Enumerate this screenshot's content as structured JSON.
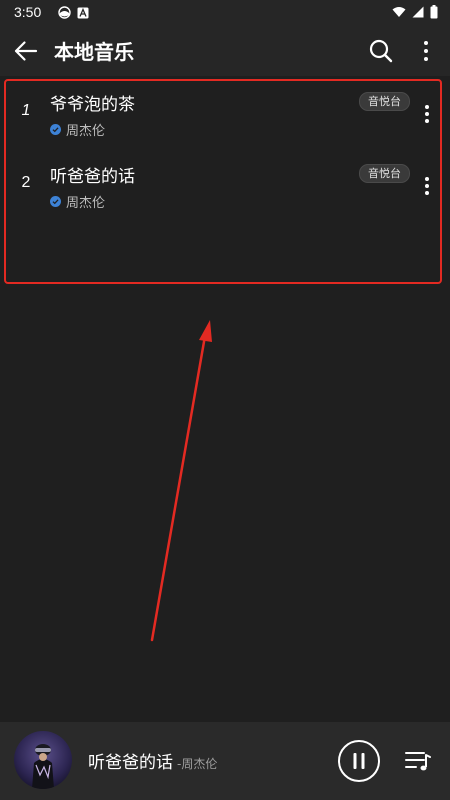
{
  "status_bar": {
    "time": "3:50"
  },
  "app_bar": {
    "title": "本地音乐"
  },
  "songs": [
    {
      "index": "1",
      "title": "爷爷泡的茶",
      "artist": "周杰伦",
      "badge": "音悦台"
    },
    {
      "index": "2",
      "title": "听爸爸的话",
      "artist": "周杰伦",
      "badge": "音悦台"
    }
  ],
  "player": {
    "title": "听爸爸的话",
    "separator": "-",
    "artist": "周杰伦"
  },
  "colors": {
    "background": "#1f1f1f",
    "bars": "#262626",
    "player_bar": "#2a2a2a",
    "verified_blue": "#3d82d6",
    "annotation_red": "#e32a22"
  },
  "icons": [
    "back-arrow-icon",
    "search-icon",
    "more-vert-icon",
    "verified-icon",
    "pause-icon",
    "playlist-icon",
    "wifi-icon",
    "signal-icon",
    "battery-icon"
  ]
}
